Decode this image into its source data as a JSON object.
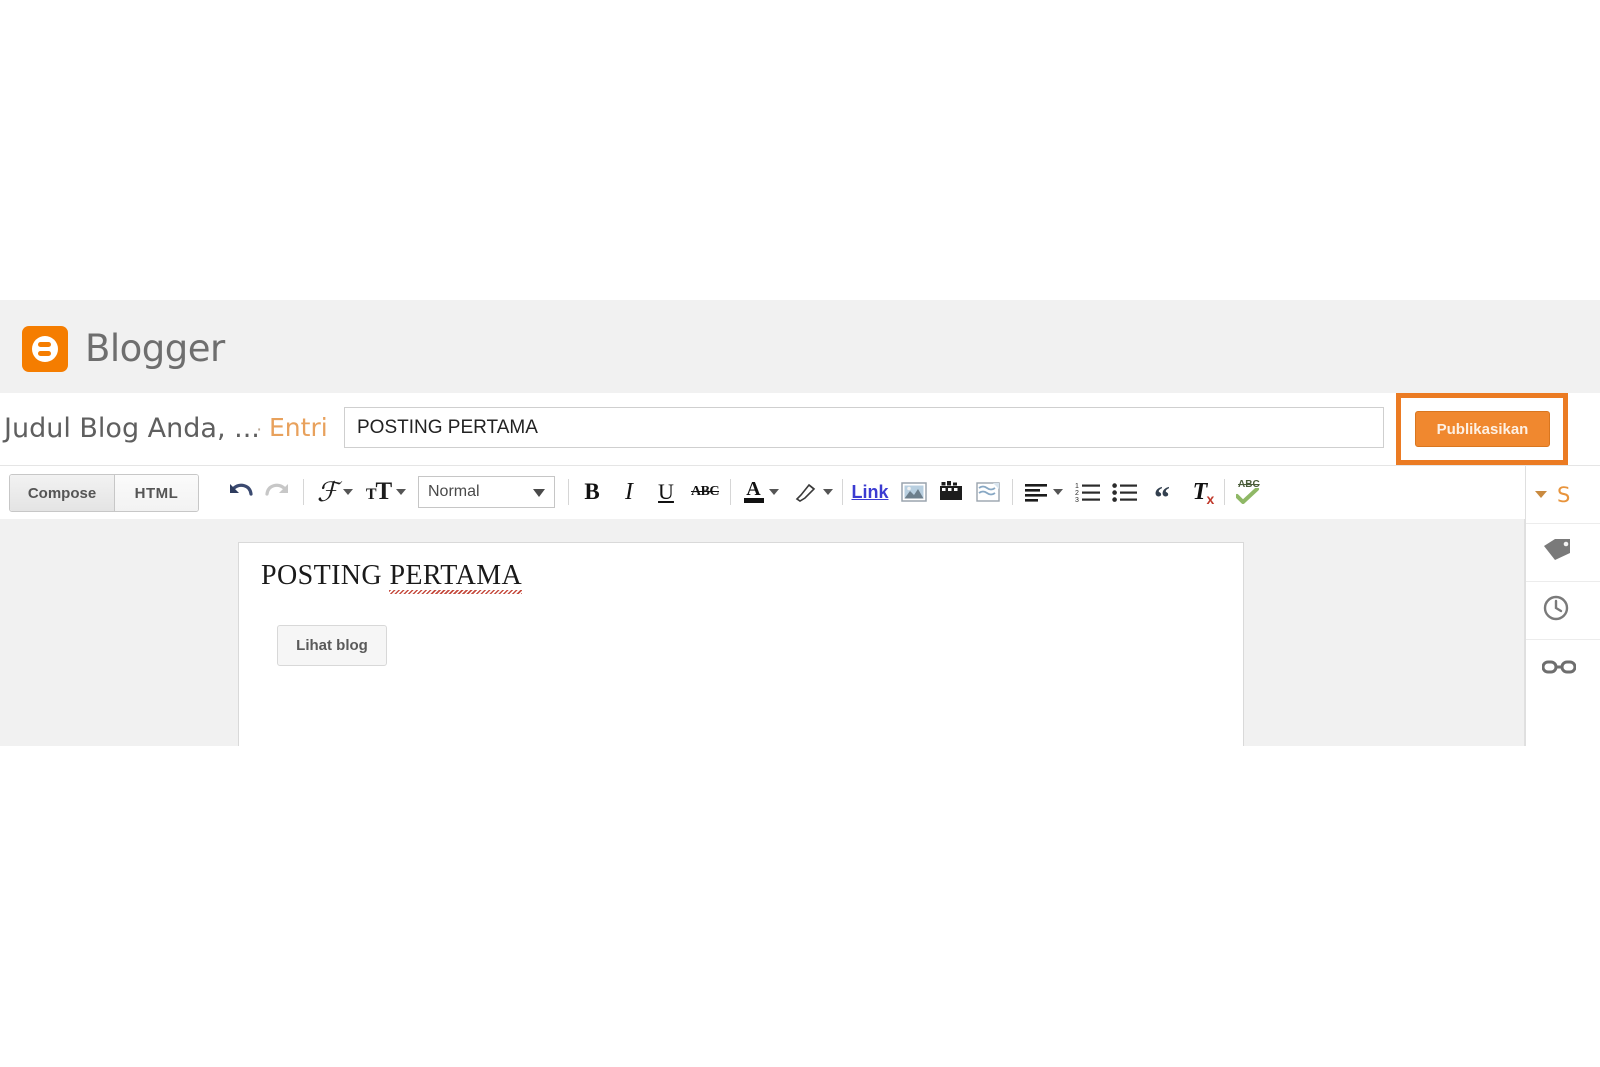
{
  "app": {
    "brand_name": "Blogger",
    "logo_icon": "blogger-logo-icon",
    "view_blog_label": "Lihat blog"
  },
  "titlebar": {
    "blog_title": "Judul Blog Anda, ...",
    "separator": "·",
    "entry_label": "Entri",
    "post_title_value": "POSTING PERTAMA",
    "post_title_placeholder": "Judul entri",
    "publish_label": "Publikasikan"
  },
  "toolbar": {
    "mode_compose": "Compose",
    "mode_html": "HTML",
    "style_selected": "Normal",
    "buttons": [
      {
        "name": "undo-icon",
        "glyph": "↶",
        "state": "enabled"
      },
      {
        "name": "redo-icon",
        "glyph": "↷",
        "state": "disabled"
      },
      {
        "name": "font-family-icon",
        "glyph": "ℱ",
        "state": "enabled"
      },
      {
        "name": "font-size-icon",
        "glyph": "TT",
        "state": "enabled"
      },
      {
        "name": "bold-icon",
        "glyph": "B",
        "state": "enabled"
      },
      {
        "name": "italic-icon",
        "glyph": "I",
        "state": "enabled"
      },
      {
        "name": "underline-icon",
        "glyph": "U",
        "state": "enabled"
      },
      {
        "name": "strikethrough-icon",
        "glyph": "ABC",
        "state": "enabled"
      },
      {
        "name": "text-color-icon",
        "glyph": "A",
        "state": "enabled"
      },
      {
        "name": "highlight-color-icon",
        "glyph": "marker",
        "state": "enabled"
      },
      {
        "name": "link-button",
        "glyph": "Link",
        "state": "enabled"
      },
      {
        "name": "insert-image-icon",
        "glyph": "image",
        "state": "enabled"
      },
      {
        "name": "insert-video-icon",
        "glyph": "film",
        "state": "enabled"
      },
      {
        "name": "jump-break-icon",
        "glyph": "break",
        "state": "enabled"
      },
      {
        "name": "align-icon",
        "glyph": "align",
        "state": "enabled"
      },
      {
        "name": "numbered-list-icon",
        "glyph": "ol",
        "state": "enabled"
      },
      {
        "name": "bullet-list-icon",
        "glyph": "ul",
        "state": "enabled"
      },
      {
        "name": "blockquote-icon",
        "glyph": "“",
        "state": "enabled"
      },
      {
        "name": "remove-formatting-icon",
        "glyph": "Tx",
        "state": "enabled"
      },
      {
        "name": "spellcheck-icon",
        "glyph": "ABC-check",
        "state": "enabled"
      }
    ],
    "link_label": "Link"
  },
  "editor": {
    "content_prefix": "POSTING ",
    "content_misspelled": "PERTAMA"
  },
  "sidebar": {
    "items": [
      {
        "name": "sidebar-settings",
        "label": "S",
        "icon": "chevron-down-icon"
      },
      {
        "name": "sidebar-labels",
        "label": "",
        "icon": "tag-icon"
      },
      {
        "name": "sidebar-schedule",
        "label": "",
        "icon": "clock-icon"
      },
      {
        "name": "sidebar-permalink",
        "label": "",
        "icon": "link-chain-icon"
      }
    ]
  },
  "colors": {
    "brand_orange": "#f57d00",
    "publish_orange": "#f0882f",
    "highlight_orange": "#eb7b23",
    "entry_orange": "#e8a15c",
    "header_gray": "#f1f1f1",
    "editor_bg": "#f1f1f1",
    "spell_error": "#c0392b"
  }
}
